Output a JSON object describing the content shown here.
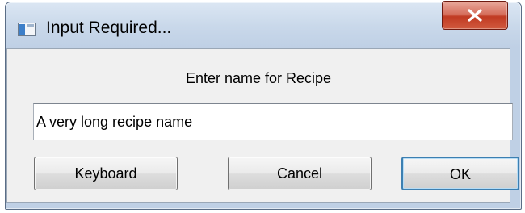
{
  "window": {
    "title": "Input Required...",
    "icons": {
      "app": "app-window-icon",
      "close": "close-icon"
    }
  },
  "dialog": {
    "prompt": "Enter name for Recipe",
    "input_value": "A very long recipe name"
  },
  "buttons": {
    "keyboard_label": "Keyboard",
    "cancel_label": "Cancel",
    "ok_label": "OK"
  },
  "colors": {
    "title_bar": "#c9d8ea",
    "close_button": "#c03a22",
    "dialog_background": "#f0f0f0",
    "default_button_border": "#3c7fb1"
  }
}
